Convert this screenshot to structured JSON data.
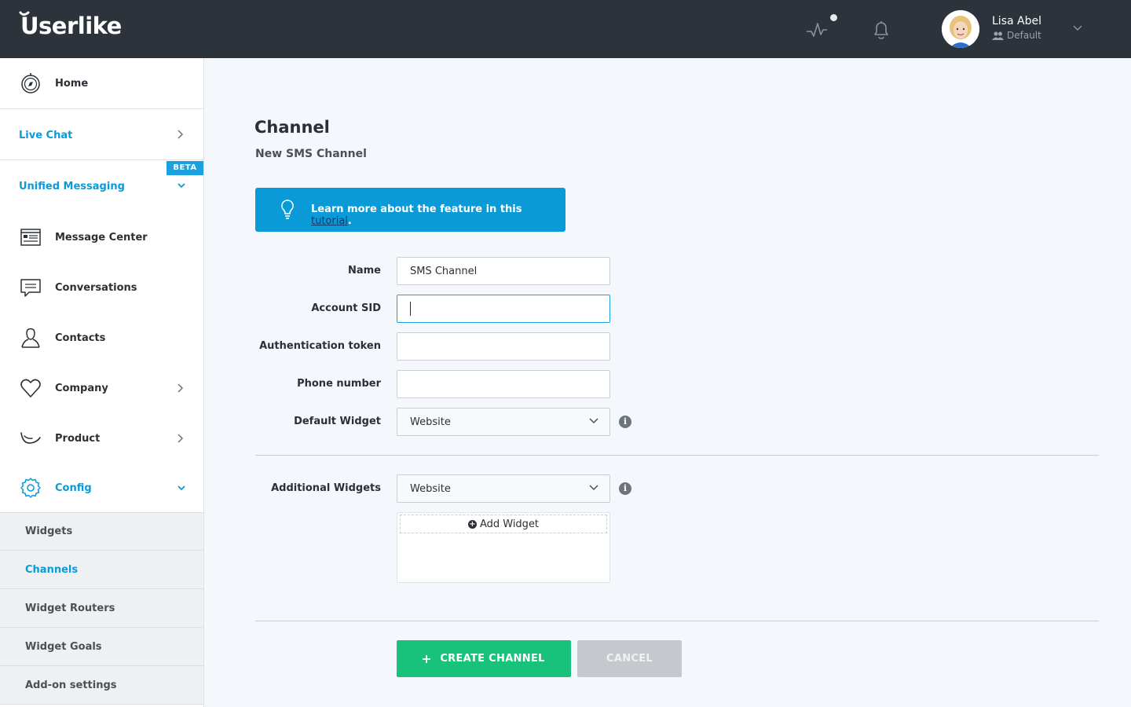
{
  "topbar": {
    "logo": "Userlike",
    "user_name": "Lisa Abel",
    "user_role": "Default"
  },
  "sidebar": {
    "home": "Home",
    "live_chat": "Live Chat",
    "unified_messaging": "Unified Messaging",
    "beta_badge": "BETA",
    "message_center": "Message Center",
    "conversations": "Conversations",
    "contacts": "Contacts",
    "company": "Company",
    "product": "Product",
    "config": "Config",
    "sub_items": [
      "Widgets",
      "Channels",
      "Widget Routers",
      "Widget Goals",
      "Add-on settings"
    ],
    "active_sub_item": "Channels"
  },
  "main": {
    "title": "Channel",
    "subtitle": "New SMS Channel",
    "tutorial_text": "Learn more about the feature in this ",
    "tutorial_link": "tutorial",
    "tutorial_suffix": "."
  },
  "form": {
    "name_label": "Name",
    "name_value": "SMS Channel",
    "account_sid_label": "Account SID",
    "account_sid_value": "",
    "auth_token_label": "Authentication token",
    "auth_token_value": "",
    "phone_label": "Phone number",
    "phone_value": "",
    "default_widget_label": "Default Widget",
    "default_widget_value": "Website",
    "additional_widgets_label": "Additional Widgets",
    "additional_widgets_value": "Website",
    "add_widget_label": "Add Widget"
  },
  "actions": {
    "create_label": "CREATE CHANNEL",
    "cancel_label": "CANCEL"
  },
  "colors": {
    "topbar": "#2c333b",
    "accent": "#0a9ad8",
    "create_button": "#19c27a",
    "cancel_button": "#c5c9ce"
  }
}
